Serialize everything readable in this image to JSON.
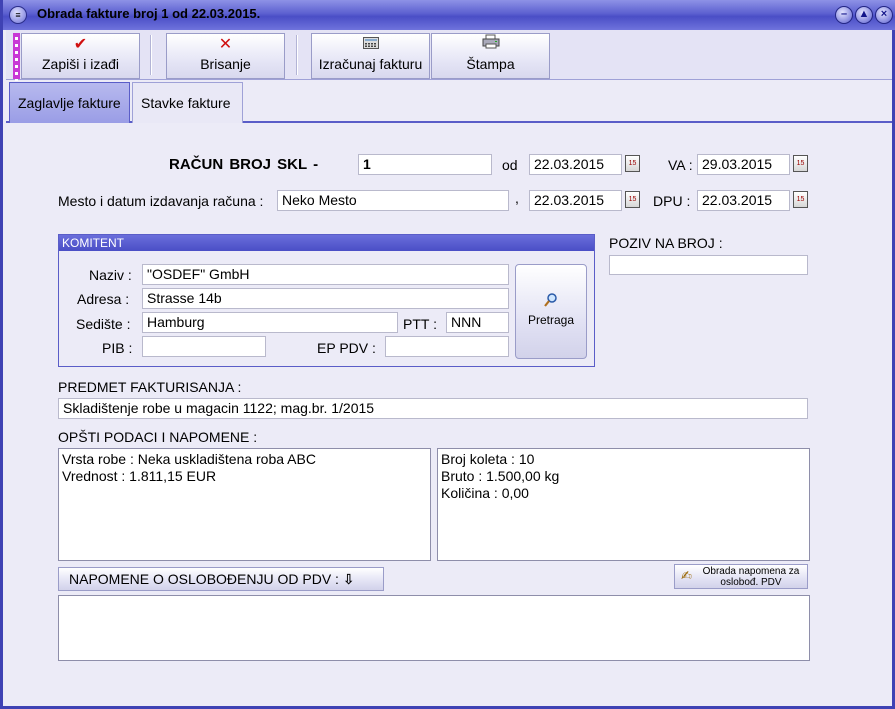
{
  "window": {
    "title": "Obrada fakture broj 1 od 22.03.2015."
  },
  "toolbar": {
    "save_label": "Zapiši i izađi",
    "delete_label": "Brisanje",
    "calc_label": "Izračunaj fakturu",
    "print_label": "Štampa"
  },
  "tabs": [
    {
      "label": "Zaglavlje fakture"
    },
    {
      "label": "Stavke fakture"
    }
  ],
  "header": {
    "invoice_label": "RAČUN  BROJ  SKL  -",
    "invoice_number": "1",
    "od_label": "od",
    "od_date": "22.03.2015",
    "va_label": "VA :",
    "va_date": "29.03.2015",
    "place_label": "Mesto i datum izdavanja računa :",
    "place_value": "Neko Mesto",
    "comma": ",",
    "issue_date": "22.03.2015",
    "dpu_label": "DPU :",
    "dpu_date": "22.03.2015"
  },
  "komitent": {
    "title": "KOMITENT",
    "naziv_label": "Naziv :",
    "naziv": "\"OSDEF\" GmbH",
    "adresa_label": "Adresa :",
    "adresa": "Strasse 14b",
    "sediste_label": "Sedište :",
    "sediste": "Hamburg",
    "ptt_label": "PTT :",
    "ptt": "NNN",
    "pib_label": "PIB :",
    "pib": "",
    "eppdv_label": "EP PDV :",
    "eppdv": "",
    "search_label": "Pretraga"
  },
  "poziv": {
    "label": "POZIV NA BROJ :",
    "value": ""
  },
  "predmet": {
    "label": "PREDMET FAKTURISANJA :",
    "value": "Skladištenje robe u magacin 1122; mag.br. 1/2015"
  },
  "opsti": {
    "label": "OPŠTI PODACI I NAPOMENE :",
    "left_lines": [
      "Vrsta robe : Neka uskladištena roba ABC",
      "Vrednost : 1.811,15 EUR"
    ],
    "right_lines": [
      "Broj koleta : 10",
      "Bruto : 1.500,00 kg",
      "Količina : 0,00"
    ]
  },
  "pdv": {
    "button_label": "NAPOMENE O OSLOBOĐENJU OD PDV :",
    "edit_label_1": "Obrada napomena za",
    "edit_label_2": "oslobođ. PDV",
    "text": ""
  }
}
